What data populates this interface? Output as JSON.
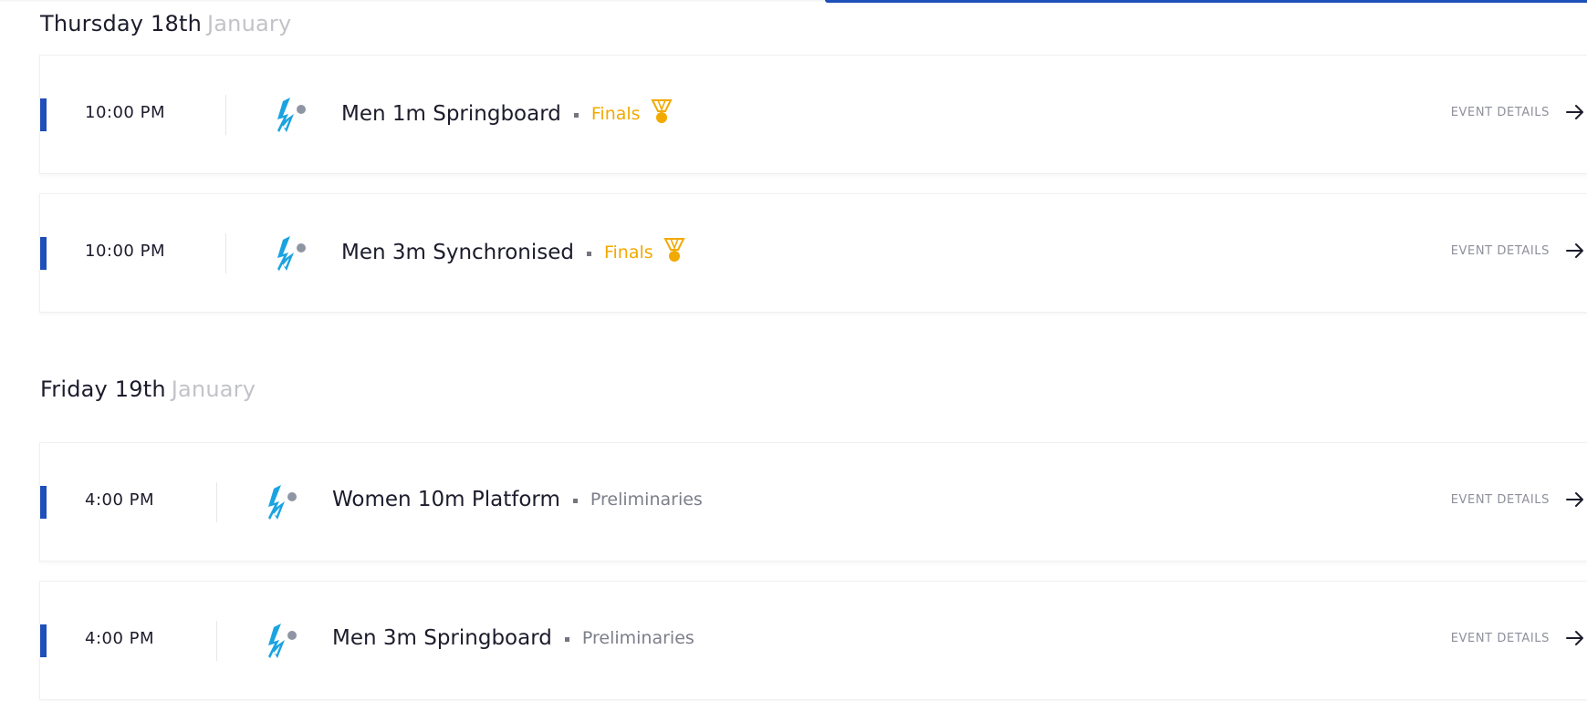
{
  "days": [
    {
      "day_label": "Thursday 18th",
      "month_label": "January",
      "events": [
        {
          "time": "10:00 PM",
          "title": "Men 1m Springboard",
          "phase": "Finals",
          "phase_type": "final",
          "has_medal": true,
          "sport_icon": "diving-icon",
          "details_label": "EVENT DETAILS"
        },
        {
          "time": "10:00 PM",
          "title": "Men 3m Synchronised",
          "phase": "Finals",
          "phase_type": "final",
          "has_medal": true,
          "sport_icon": "diving-icon",
          "details_label": "EVENT DETAILS"
        }
      ]
    },
    {
      "day_label": "Friday 19th",
      "month_label": "January",
      "events": [
        {
          "time": "4:00 PM",
          "title": "Women 10m Platform",
          "phase": "Preliminaries",
          "phase_type": "preliminary",
          "has_medal": false,
          "sport_icon": "diving-icon",
          "details_label": "EVENT DETAILS"
        },
        {
          "time": "4:00 PM",
          "title": "Men 3m Springboard",
          "phase": "Preliminaries",
          "phase_type": "preliminary",
          "has_medal": false,
          "sport_icon": "diving-icon",
          "details_label": "EVENT DETAILS"
        }
      ]
    }
  ],
  "colors": {
    "accent": "#1f4fb8",
    "final": "#f2a900",
    "preliminary": "#7c7e8a",
    "diving_icon": "#1aa3e0",
    "text": "#1c1c2c",
    "muted": "#c2c3c8"
  }
}
